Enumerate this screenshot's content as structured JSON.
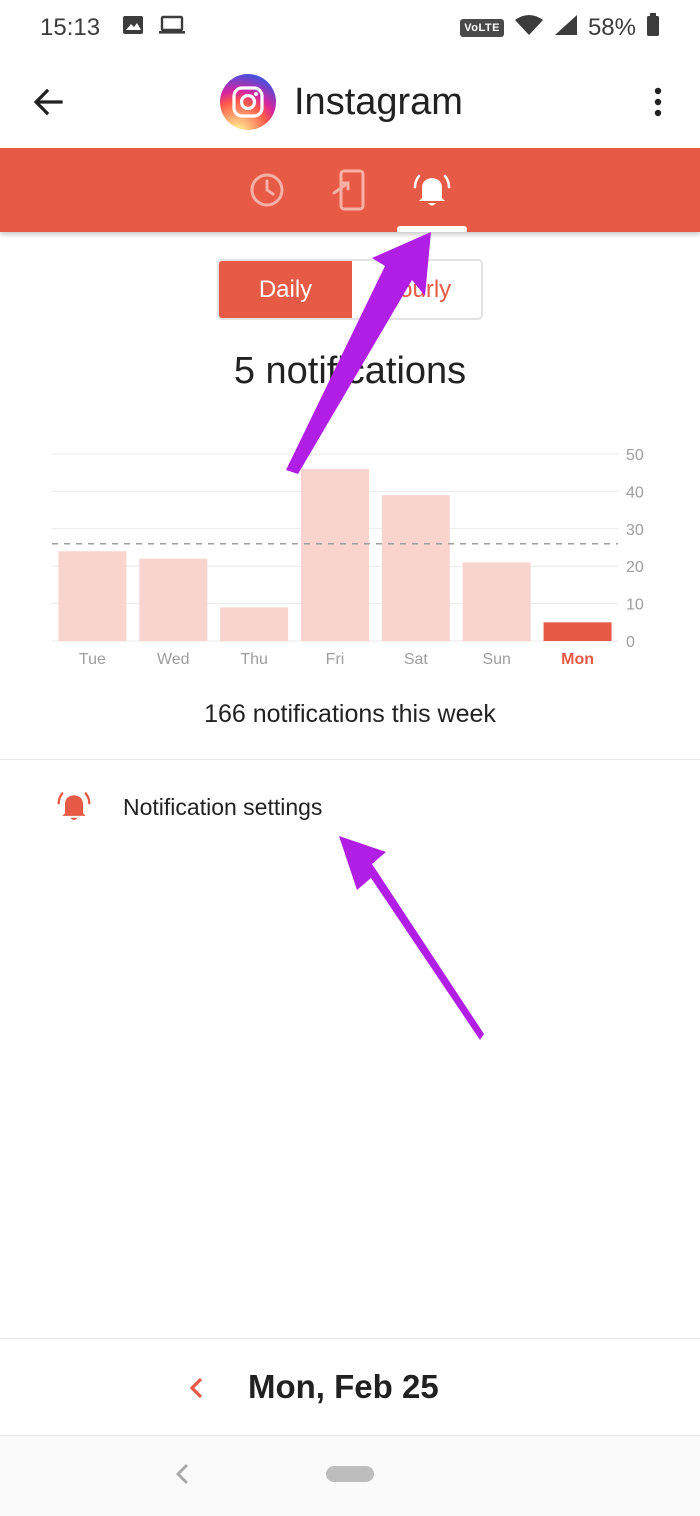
{
  "status_bar": {
    "time": "15:13",
    "network_badge": "VoLTE",
    "battery": "58%"
  },
  "app_bar": {
    "title": "Instagram"
  },
  "tabs": [
    {
      "name": "screen-time",
      "icon": "clock-icon"
    },
    {
      "name": "unlocks",
      "icon": "phone-unlock-icon"
    },
    {
      "name": "notifications",
      "icon": "bell-icon",
      "selected": true
    }
  ],
  "toggle": {
    "daily_label": "Daily",
    "hourly_label": "Hourly",
    "selected": "Daily"
  },
  "headline": "5 notifications",
  "chart_data": {
    "type": "bar",
    "categories": [
      "Tue",
      "Wed",
      "Thu",
      "Fri",
      "Sat",
      "Sun",
      "Mon"
    ],
    "values": [
      24,
      22,
      9,
      46,
      39,
      21,
      5
    ],
    "highlighted_category": "Mon",
    "ylim": [
      0,
      50
    ],
    "yticks": [
      0,
      10,
      20,
      30,
      40,
      50
    ],
    "average_line": 26,
    "grid": true,
    "colors": {
      "bar": "#f9d4cf",
      "highlight": "#e75a45",
      "grid": "#eaeaea",
      "tick": "#9e9e9e"
    }
  },
  "weekly_summary": "166 notifications this week",
  "settings": {
    "notification_settings_label": "Notification settings"
  },
  "date_nav": {
    "date_label": "Mon, Feb 25"
  },
  "colors": {
    "accent": "#e75a45",
    "annotation_arrow": "#b11ee6"
  }
}
